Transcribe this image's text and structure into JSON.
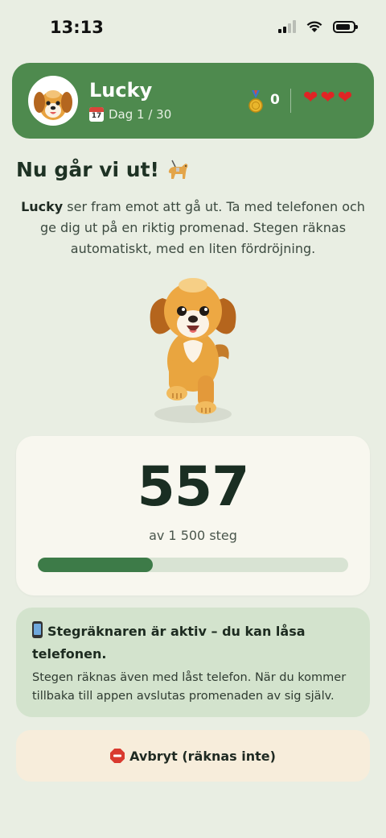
{
  "status_bar": {
    "time": "13:13"
  },
  "header": {
    "pet_name": "Lucky",
    "day_label": "Dag 1 / 30",
    "calendar_day": "17",
    "medal_count": "0",
    "hearts": 3
  },
  "title": "Nu går vi ut!",
  "description": {
    "name": "Lucky",
    "text": " ser fram emot att gå ut. Ta med telefonen och ge dig ut på en riktig promenad. Stegen räknas automatiskt, med en liten fördröjning."
  },
  "steps": {
    "count": "557",
    "goal_label": "av 1 500 steg",
    "progress_fraction": 0.37
  },
  "info": {
    "title": "Stegräknaren är aktiv – du kan låsa telefonen.",
    "body": "Stegen räknas även med låst telefon. När du kommer tillbaka till appen avslutas promenaden av sig själv."
  },
  "cancel_button": {
    "label": "Avbryt (räknas inte)"
  },
  "colors": {
    "header_green": "#4e8a4e",
    "progress_fill": "#3d7b48",
    "info_bg": "#d3e3cd",
    "cancel_bg": "#f7eddb"
  }
}
